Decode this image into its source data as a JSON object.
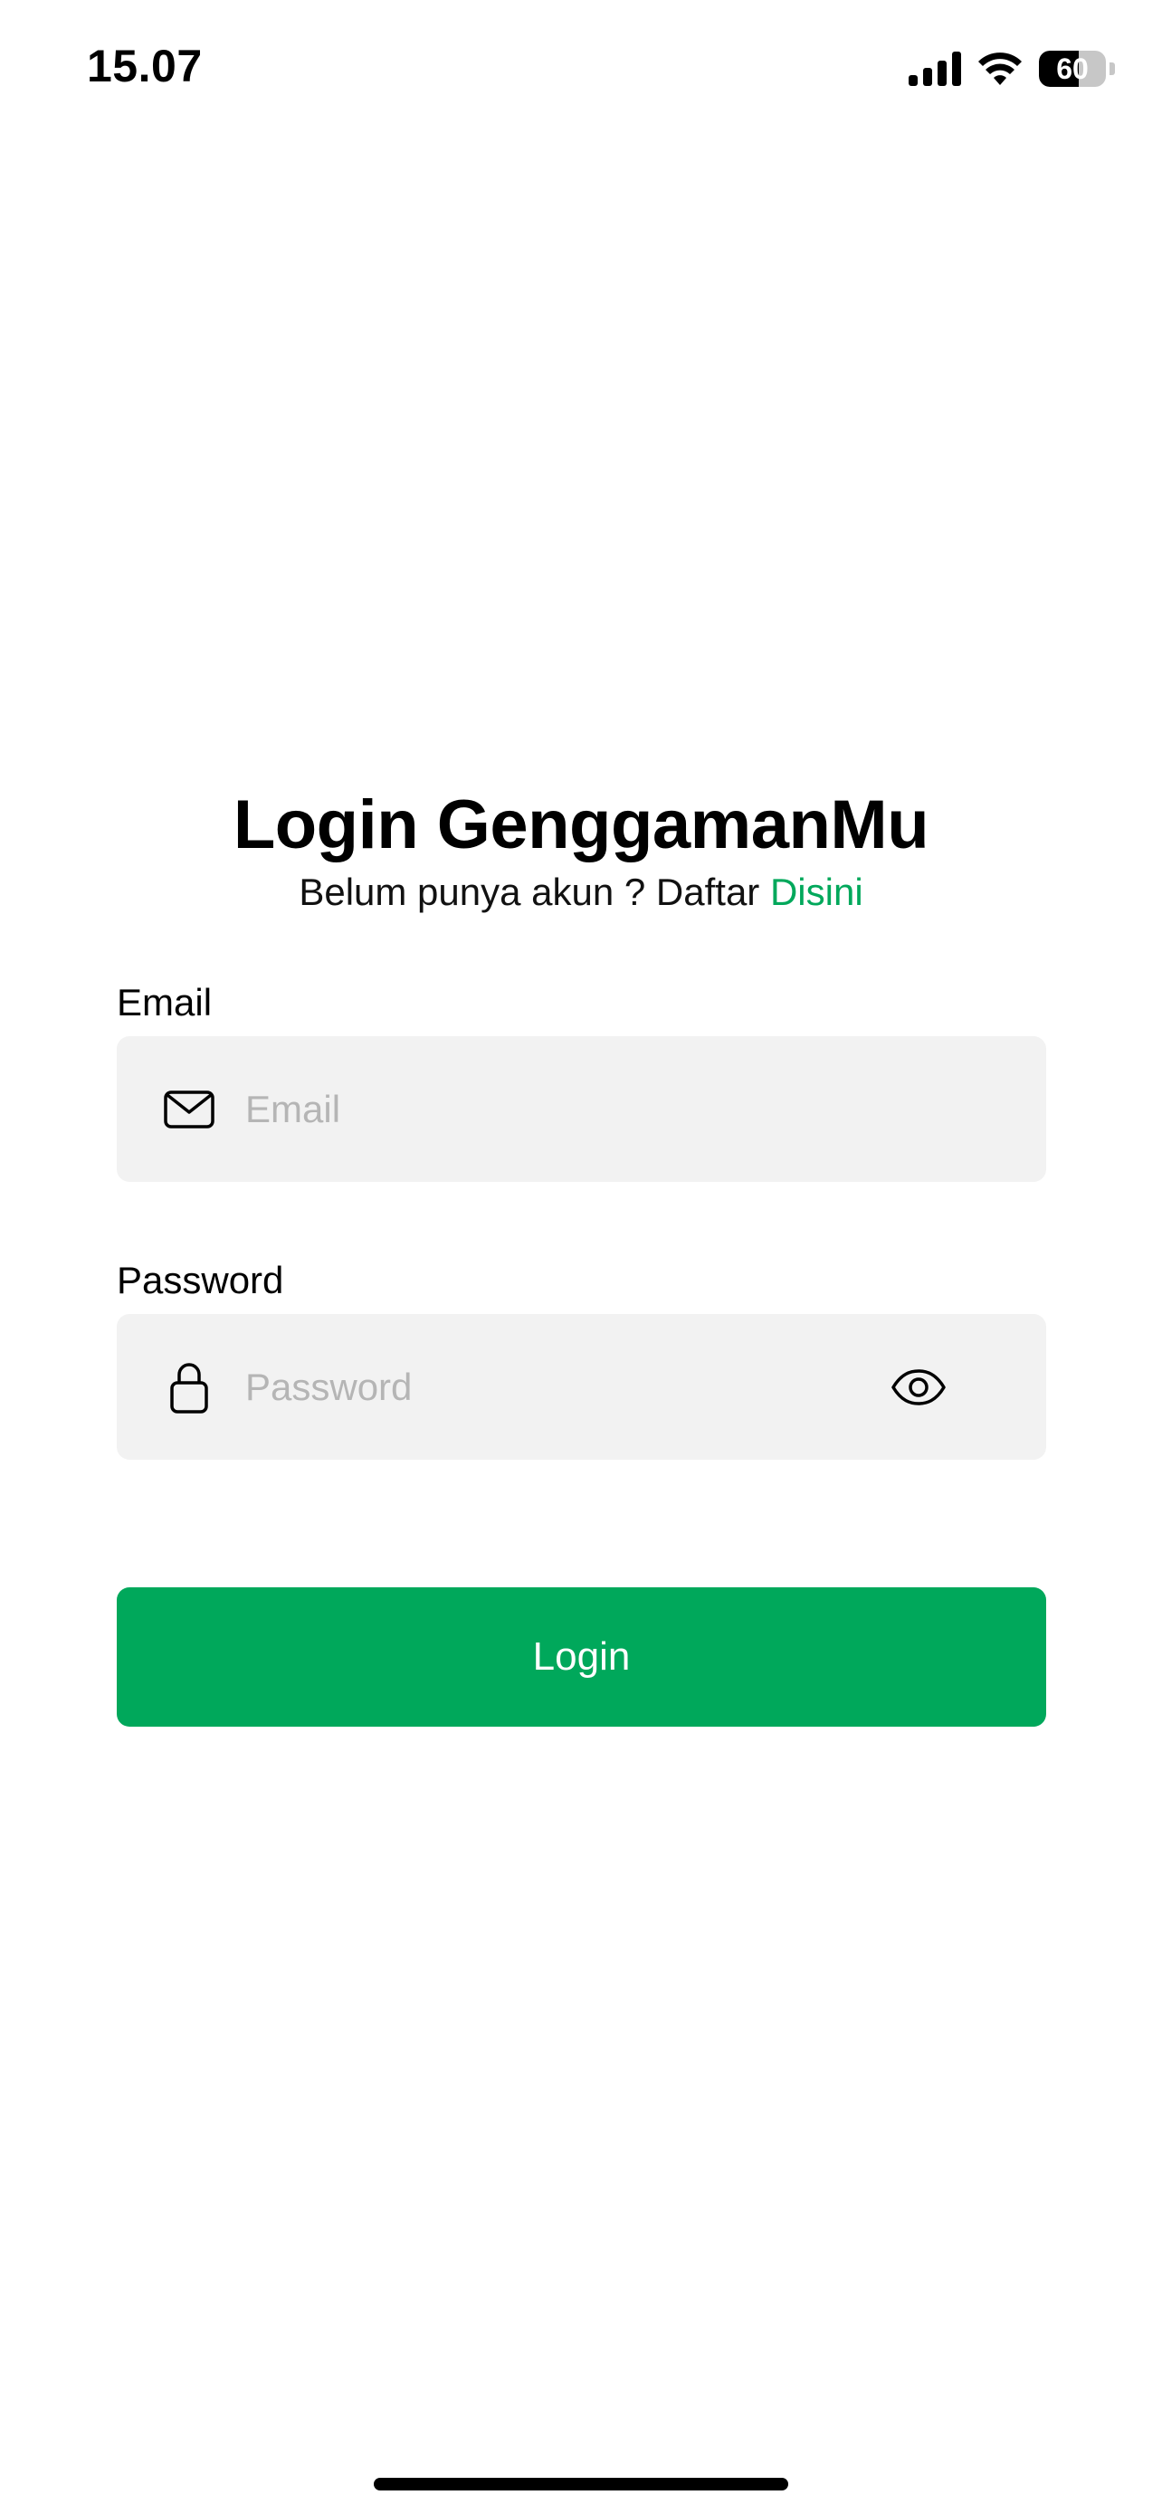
{
  "status_bar": {
    "time": "15.07",
    "battery_level": "60",
    "battery_fraction": 0.6,
    "icons": [
      "signal-icon",
      "wifi-icon",
      "battery-icon"
    ]
  },
  "header": {
    "title": "Login GenggamanMu",
    "subtitle_prefix": "Belum punya akun ? Daftar ",
    "subtitle_link": "Disini"
  },
  "form": {
    "email": {
      "label": "Email",
      "placeholder": "Email",
      "value": "",
      "icon": "mail-icon"
    },
    "password": {
      "label": "Password",
      "placeholder": "Password",
      "value": "",
      "icon": "lock-icon",
      "toggle_icon": "eye-icon"
    },
    "submit_label": "Login"
  },
  "colors": {
    "accent": "#00a85b",
    "field_background": "#f2f2f2",
    "placeholder": "#b5b5b5"
  }
}
